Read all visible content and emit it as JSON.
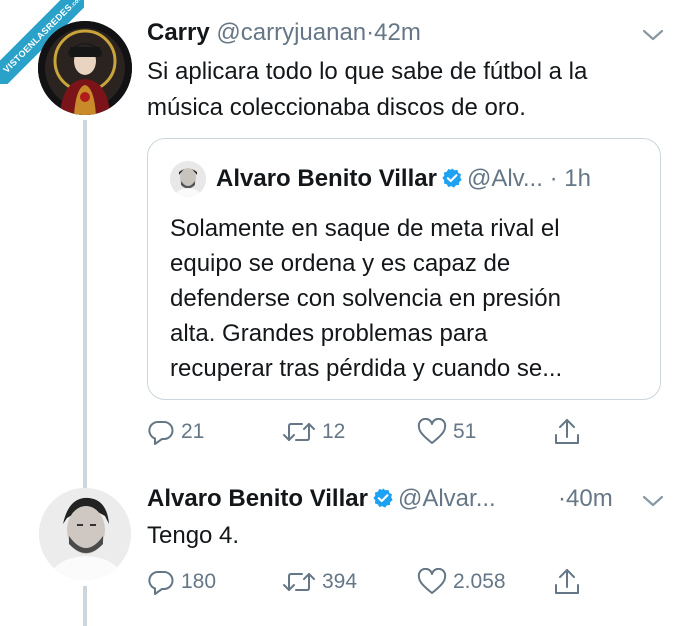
{
  "watermark": {
    "text": "VISTOENLASREDES",
    "sub": ".com"
  },
  "tweet1": {
    "name": "Carry",
    "handle": "@carryjuanan",
    "dot": "·",
    "time": "42m",
    "text_line1": "Si aplicara todo lo que sabe de fútbol a la",
    "text_line2": "música coleccionaba discos de oro.",
    "quoted": {
      "name": "Alvaro Benito Villar",
      "handle": "@Alv...",
      "dot": "·",
      "time": "1h",
      "lines": [
        "Solamente en saque de meta rival el",
        "equipo se ordena y es capaz de",
        "defenderse con solvencia en presión",
        "alta. Grandes problemas para",
        "recuperar tras pérdida y cuando se..."
      ]
    },
    "replies": "21",
    "retweets": "12",
    "likes": "51"
  },
  "tweet2": {
    "name": "Alvaro Benito Villar",
    "handle": "@Alvar...",
    "dot": "·",
    "time": "40m",
    "text": "Tengo 4.",
    "replies": "180",
    "retweets": "394",
    "likes": "2.058"
  },
  "colors": {
    "text": "#14171a",
    "secondary": "#657786",
    "verified": "#1da1f2",
    "watermark": "#2aa1c9"
  }
}
